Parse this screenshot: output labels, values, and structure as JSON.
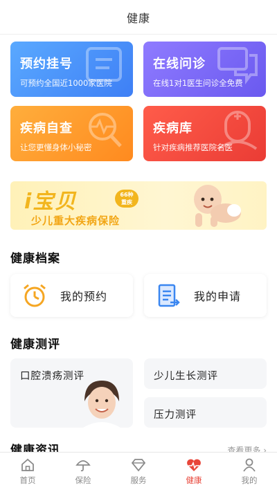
{
  "header": {
    "title": "健康"
  },
  "services": [
    {
      "title": "预约挂号",
      "subtitle": "可预约全国近1000家医院",
      "icon": "registration-icon",
      "color": "#4a94fa"
    },
    {
      "title": "在线问诊",
      "subtitle": "在线1对1医生问诊全免费",
      "icon": "chat-bubbles-icon",
      "color": "#7a68f5"
    },
    {
      "title": "疾病自查",
      "subtitle": "让您更懂身体小秘密",
      "icon": "magnifier-pulse-icon",
      "color": "#ff9a2c"
    },
    {
      "title": "疾病库",
      "subtitle": "针对疾病推荐医院名医",
      "icon": "doctor-icon",
      "color": "#f24a3e"
    }
  ],
  "banner": {
    "brand": "i宝贝",
    "badge_line1": "66种",
    "badge_line2": "重疾",
    "subtitle": "少儿重大疾病保险",
    "image": "crawling-baby"
  },
  "records": {
    "title": "健康档案",
    "items": [
      {
        "label": "我的预约",
        "icon": "alarm-clock-icon"
      },
      {
        "label": "我的申请",
        "icon": "document-arrow-icon"
      }
    ]
  },
  "assessment": {
    "title": "健康测评",
    "items": [
      {
        "label": "口腔溃疡测评",
        "image": "smiling-child"
      },
      {
        "label": "少儿生长测评"
      },
      {
        "label": "压力测评"
      }
    ]
  },
  "news": {
    "title": "健康资讯",
    "more": "查看更多"
  },
  "tabs": [
    {
      "label": "首页",
      "icon": "home-icon"
    },
    {
      "label": "保险",
      "icon": "umbrella-icon"
    },
    {
      "label": "服务",
      "icon": "diamond-icon"
    },
    {
      "label": "健康",
      "icon": "heart-pulse-icon",
      "active": true
    },
    {
      "label": "我的",
      "icon": "user-icon"
    }
  ],
  "colors": {
    "accent": "#e8463a",
    "banner_gold": "#f2b51e"
  }
}
